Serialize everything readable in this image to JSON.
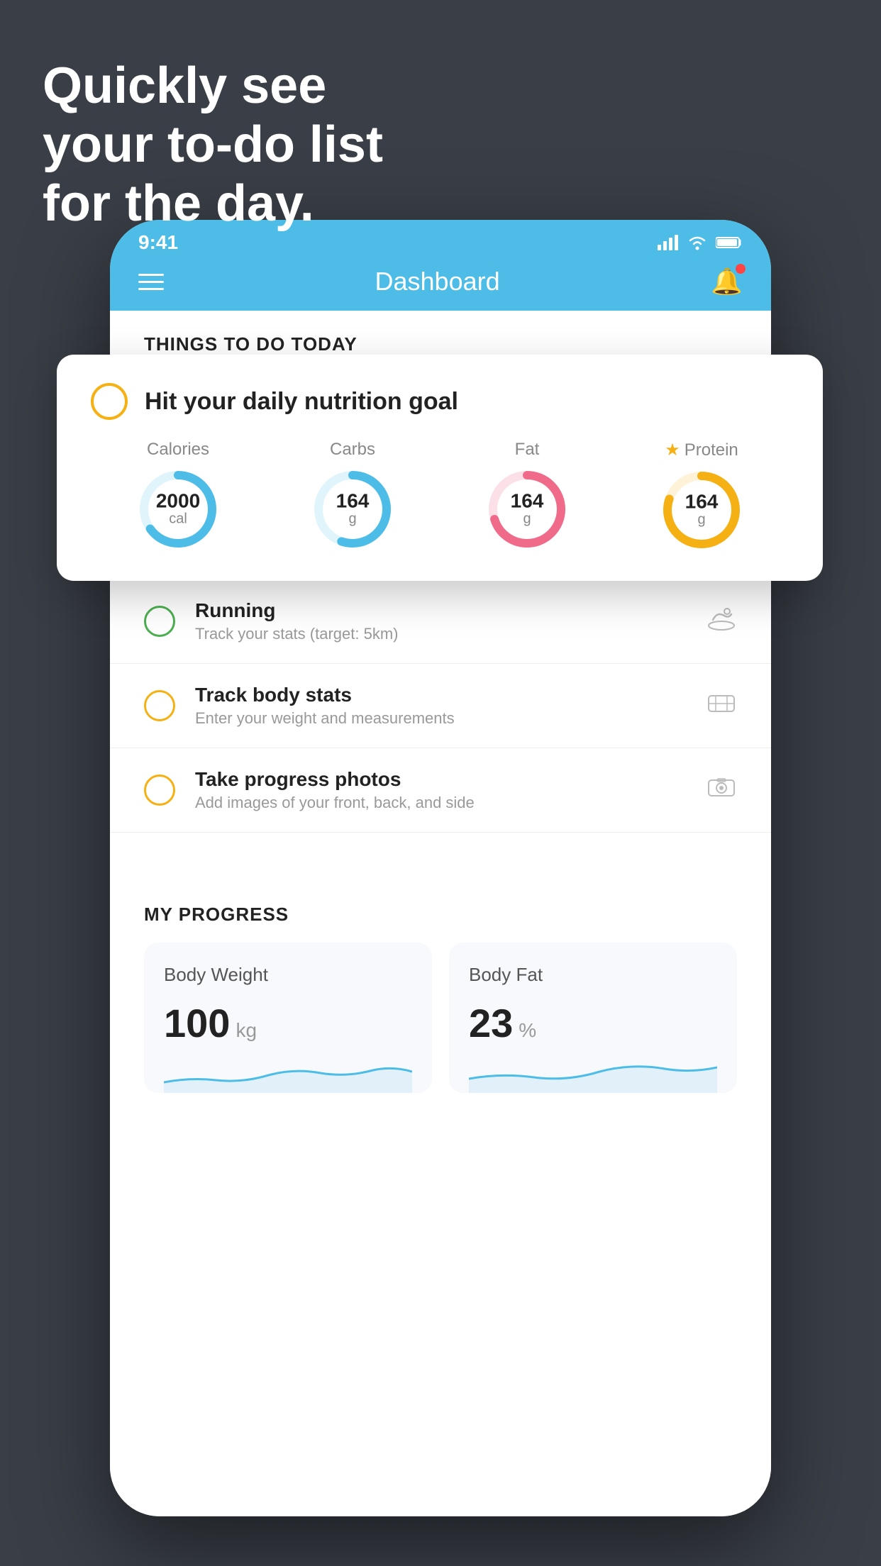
{
  "hero": {
    "line1": "Quickly see",
    "line2": "your to-do list",
    "line3": "for the day."
  },
  "statusBar": {
    "time": "9:41",
    "signal": "▲▲▲▲",
    "wifi": "wifi",
    "battery": "battery"
  },
  "navBar": {
    "title": "Dashboard"
  },
  "sectionTitle": "THINGS TO DO TODAY",
  "nutritionCard": {
    "circleColor": "#f5b014",
    "title": "Hit your daily nutrition goal",
    "items": [
      {
        "label": "Calories",
        "value": "2000",
        "unit": "cal",
        "color": "#4dbde8",
        "trackColor": "#e0f4fc",
        "percent": 65
      },
      {
        "label": "Carbs",
        "value": "164",
        "unit": "g",
        "color": "#4dbde8",
        "trackColor": "#e0f4fc",
        "percent": 55
      },
      {
        "label": "Fat",
        "value": "164",
        "unit": "g",
        "color": "#f06b8a",
        "trackColor": "#fce0e8",
        "percent": 70
      },
      {
        "label": "Protein",
        "value": "164",
        "unit": "g",
        "color": "#f5b014",
        "trackColor": "#fef3d8",
        "percent": 80,
        "star": true
      }
    ]
  },
  "todoItems": [
    {
      "title": "Running",
      "subtitle": "Track your stats (target: 5km)",
      "circleColor": "green",
      "icon": "👟"
    },
    {
      "title": "Track body stats",
      "subtitle": "Enter your weight and measurements",
      "circleColor": "yellow",
      "icon": "⚖"
    },
    {
      "title": "Take progress photos",
      "subtitle": "Add images of your front, back, and side",
      "circleColor": "yellow",
      "icon": "🖼"
    }
  ],
  "progressSection": {
    "title": "MY PROGRESS",
    "cards": [
      {
        "title": "Body Weight",
        "value": "100",
        "unit": "kg"
      },
      {
        "title": "Body Fat",
        "value": "23",
        "unit": "%"
      }
    ]
  }
}
